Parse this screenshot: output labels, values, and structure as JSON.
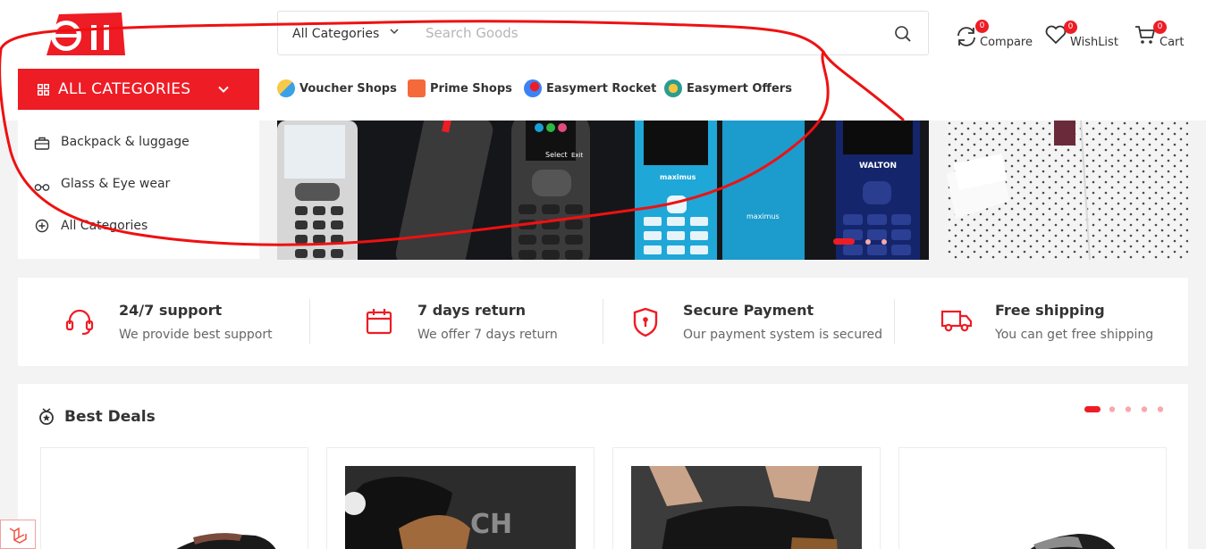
{
  "header": {
    "logo_text": "e",
    "search": {
      "category_label": "All Categories",
      "placeholder": "Search Goods"
    },
    "actions": [
      {
        "label": "Compare",
        "count": "0",
        "icon": "compare-icon"
      },
      {
        "label": "WishList",
        "count": "0",
        "icon": "heart-icon"
      },
      {
        "label": "Cart",
        "count": "0",
        "icon": "cart-icon"
      }
    ]
  },
  "nav": {
    "all_categories_label": "ALL CATEGORIES",
    "links": [
      {
        "label": "Voucher Shops",
        "icon": "voucher-shop-icon"
      },
      {
        "label": "Prime Shops",
        "icon": "prime-shop-icon"
      },
      {
        "label": "Easymert Rocket",
        "icon": "rocket-icon"
      },
      {
        "label": "Easymert Offers",
        "icon": "offers-icon"
      }
    ]
  },
  "categories": [
    {
      "label": "Backpack & luggage",
      "icon": "backpack-icon"
    },
    {
      "label": "Glass & Eye wear",
      "icon": "glasses-icon"
    },
    {
      "label": "All Categories",
      "icon": "plus-circle-icon"
    }
  ],
  "banner": {
    "phone_texts": [
      "Select",
      "Exit",
      "maximus",
      "maximus",
      "WALTON"
    ],
    "slides_count": 3,
    "active_slide": 1
  },
  "features": [
    {
      "title": "24/7 support",
      "desc": "We provide best support",
      "icon": "headset-icon"
    },
    {
      "title": "7 days return",
      "desc": "We offer 7 days return",
      "icon": "calendar-icon"
    },
    {
      "title": "Secure Payment",
      "desc": "Our payment system is secured",
      "icon": "shield-icon"
    },
    {
      "title": "Free shipping",
      "desc": "You can get free shipping",
      "icon": "truck-icon"
    }
  ],
  "best_deals": {
    "title": "Best Deals",
    "pages": 5,
    "active_page": 1,
    "products": [
      {
        "image": "shoe-loafer"
      },
      {
        "image": "shoe-printed"
      },
      {
        "image": "shoe-lacing"
      },
      {
        "image": "shoe-glitter"
      }
    ]
  },
  "colors": {
    "brand": "#ee1c25",
    "annotation": "#ee1111"
  }
}
